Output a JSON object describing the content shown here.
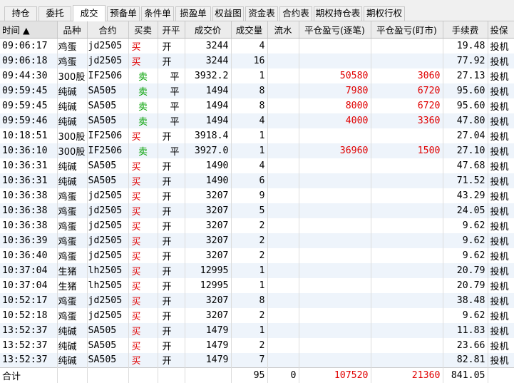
{
  "tabs": [
    {
      "label": "持仓"
    },
    {
      "label": "委托"
    },
    {
      "label": "成交"
    },
    {
      "label": "预备单"
    },
    {
      "label": "条件单"
    },
    {
      "label": "损盈单"
    },
    {
      "label": "权益图"
    },
    {
      "label": "资金表"
    },
    {
      "label": "合约表"
    },
    {
      "label": "期权持仓表"
    },
    {
      "label": "期权行权"
    }
  ],
  "active_tab": "成交",
  "columns": [
    "时间 ▲",
    "品种",
    "合约",
    "买卖",
    "开平",
    "成交价",
    "成交量",
    "流水",
    "平仓盈亏(逐笔)",
    "平仓盈亏(盯市)",
    "手续费",
    "投保"
  ],
  "sort": {
    "column": "时间",
    "direction": "ascending",
    "indicator": "▲"
  },
  "rows": [
    {
      "time": "09:06:17",
      "product": "鸡蛋",
      "contract": "jd2505",
      "side": "买",
      "oc": "开",
      "price": "3244",
      "qty": "4",
      "flow": "",
      "pnl_trade": "",
      "pnl_mtm": "",
      "fee": "19.48",
      "hedge": "投机"
    },
    {
      "time": "09:06:18",
      "product": "鸡蛋",
      "contract": "jd2505",
      "side": "买",
      "oc": "开",
      "price": "3244",
      "qty": "16",
      "flow": "",
      "pnl_trade": "",
      "pnl_mtm": "",
      "fee": "77.92",
      "hedge": "投机"
    },
    {
      "time": "09:44:30",
      "product": "300股",
      "contract": "IF2506",
      "side": "卖",
      "oc": "平",
      "price": "3932.2",
      "qty": "1",
      "flow": "",
      "pnl_trade": "50580",
      "pnl_mtm": "3060",
      "fee": "27.13",
      "hedge": "投机"
    },
    {
      "time": "09:59:45",
      "product": "纯碱",
      "contract": "SA505",
      "side": "卖",
      "oc": "平",
      "price": "1494",
      "qty": "8",
      "flow": "",
      "pnl_trade": "7980",
      "pnl_mtm": "6720",
      "fee": "95.60",
      "hedge": "投机"
    },
    {
      "time": "09:59:45",
      "product": "纯碱",
      "contract": "SA505",
      "side": "卖",
      "oc": "平",
      "price": "1494",
      "qty": "8",
      "flow": "",
      "pnl_trade": "8000",
      "pnl_mtm": "6720",
      "fee": "95.60",
      "hedge": "投机"
    },
    {
      "time": "09:59:46",
      "product": "纯碱",
      "contract": "SA505",
      "side": "卖",
      "oc": "平",
      "price": "1494",
      "qty": "4",
      "flow": "",
      "pnl_trade": "4000",
      "pnl_mtm": "3360",
      "fee": "47.80",
      "hedge": "投机"
    },
    {
      "time": "10:18:51",
      "product": "300股",
      "contract": "IF2506",
      "side": "买",
      "oc": "开",
      "price": "3918.4",
      "qty": "1",
      "flow": "",
      "pnl_trade": "",
      "pnl_mtm": "",
      "fee": "27.04",
      "hedge": "投机"
    },
    {
      "time": "10:36:10",
      "product": "300股",
      "contract": "IF2506",
      "side": "卖",
      "oc": "平",
      "price": "3927.0",
      "qty": "1",
      "flow": "",
      "pnl_trade": "36960",
      "pnl_mtm": "1500",
      "fee": "27.10",
      "hedge": "投机"
    },
    {
      "time": "10:36:31",
      "product": "纯碱",
      "contract": "SA505",
      "side": "买",
      "oc": "开",
      "price": "1490",
      "qty": "4",
      "flow": "",
      "pnl_trade": "",
      "pnl_mtm": "",
      "fee": "47.68",
      "hedge": "投机"
    },
    {
      "time": "10:36:31",
      "product": "纯碱",
      "contract": "SA505",
      "side": "买",
      "oc": "开",
      "price": "1490",
      "qty": "6",
      "flow": "",
      "pnl_trade": "",
      "pnl_mtm": "",
      "fee": "71.52",
      "hedge": "投机"
    },
    {
      "time": "10:36:38",
      "product": "鸡蛋",
      "contract": "jd2505",
      "side": "买",
      "oc": "开",
      "price": "3207",
      "qty": "9",
      "flow": "",
      "pnl_trade": "",
      "pnl_mtm": "",
      "fee": "43.29",
      "hedge": "投机"
    },
    {
      "time": "10:36:38",
      "product": "鸡蛋",
      "contract": "jd2505",
      "side": "买",
      "oc": "开",
      "price": "3207",
      "qty": "5",
      "flow": "",
      "pnl_trade": "",
      "pnl_mtm": "",
      "fee": "24.05",
      "hedge": "投机"
    },
    {
      "time": "10:36:38",
      "product": "鸡蛋",
      "contract": "jd2505",
      "side": "买",
      "oc": "开",
      "price": "3207",
      "qty": "2",
      "flow": "",
      "pnl_trade": "",
      "pnl_mtm": "",
      "fee": "9.62",
      "hedge": "投机"
    },
    {
      "time": "10:36:39",
      "product": "鸡蛋",
      "contract": "jd2505",
      "side": "买",
      "oc": "开",
      "price": "3207",
      "qty": "2",
      "flow": "",
      "pnl_trade": "",
      "pnl_mtm": "",
      "fee": "9.62",
      "hedge": "投机"
    },
    {
      "time": "10:36:40",
      "product": "鸡蛋",
      "contract": "jd2505",
      "side": "买",
      "oc": "开",
      "price": "3207",
      "qty": "2",
      "flow": "",
      "pnl_trade": "",
      "pnl_mtm": "",
      "fee": "9.62",
      "hedge": "投机"
    },
    {
      "time": "10:37:04",
      "product": "生猪",
      "contract": "lh2505",
      "side": "买",
      "oc": "开",
      "price": "12995",
      "qty": "1",
      "flow": "",
      "pnl_trade": "",
      "pnl_mtm": "",
      "fee": "20.79",
      "hedge": "投机"
    },
    {
      "time": "10:37:04",
      "product": "生猪",
      "contract": "lh2505",
      "side": "买",
      "oc": "开",
      "price": "12995",
      "qty": "1",
      "flow": "",
      "pnl_trade": "",
      "pnl_mtm": "",
      "fee": "20.79",
      "hedge": "投机"
    },
    {
      "time": "10:52:17",
      "product": "鸡蛋",
      "contract": "jd2505",
      "side": "买",
      "oc": "开",
      "price": "3207",
      "qty": "8",
      "flow": "",
      "pnl_trade": "",
      "pnl_mtm": "",
      "fee": "38.48",
      "hedge": "投机"
    },
    {
      "time": "10:52:18",
      "product": "鸡蛋",
      "contract": "jd2505",
      "side": "买",
      "oc": "开",
      "price": "3207",
      "qty": "2",
      "flow": "",
      "pnl_trade": "",
      "pnl_mtm": "",
      "fee": "9.62",
      "hedge": "投机"
    },
    {
      "time": "13:52:37",
      "product": "纯碱",
      "contract": "SA505",
      "side": "买",
      "oc": "开",
      "price": "1479",
      "qty": "1",
      "flow": "",
      "pnl_trade": "",
      "pnl_mtm": "",
      "fee": "11.83",
      "hedge": "投机"
    },
    {
      "time": "13:52:37",
      "product": "纯碱",
      "contract": "SA505",
      "side": "买",
      "oc": "开",
      "price": "1479",
      "qty": "2",
      "flow": "",
      "pnl_trade": "",
      "pnl_mtm": "",
      "fee": "23.66",
      "hedge": "投机"
    },
    {
      "time": "13:52:37",
      "product": "纯碱",
      "contract": "SA505",
      "side": "买",
      "oc": "开",
      "price": "1479",
      "qty": "7",
      "flow": "",
      "pnl_trade": "",
      "pnl_mtm": "",
      "fee": "82.81",
      "hedge": "投机"
    }
  ],
  "totals": {
    "label": "合计",
    "qty": "95",
    "flow": "0",
    "pnl_trade": "107520",
    "pnl_mtm": "21360",
    "fee": "841.05"
  },
  "colors": {
    "buy": "#e00000",
    "sell": "#00a000",
    "profit": "#e00000",
    "stripe": "#eef4fb",
    "header": "#ececec"
  }
}
